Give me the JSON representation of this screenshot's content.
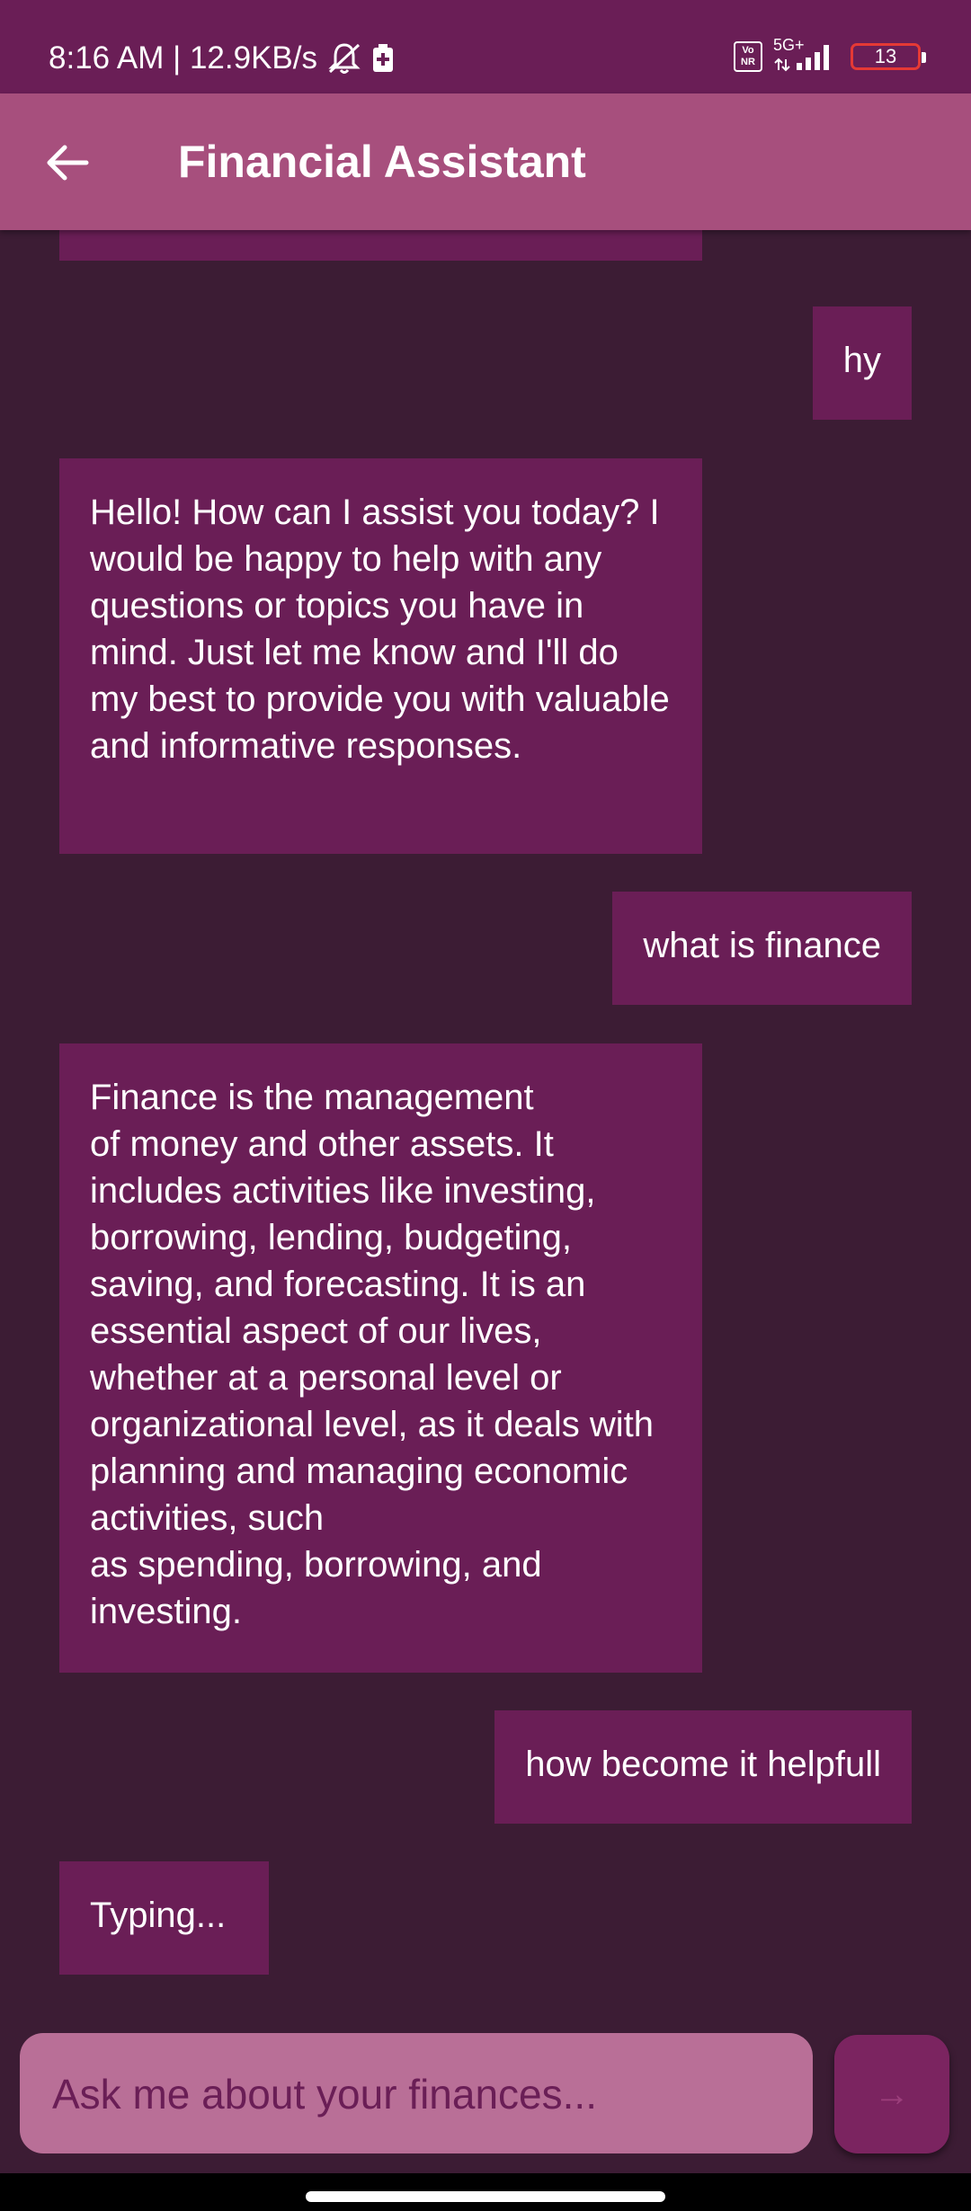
{
  "status_bar": {
    "time_speed": "8:16 AM | 12.9KB/s",
    "volte_top": "Vo",
    "volte_bottom": "NR",
    "network": "5G+",
    "battery": "13"
  },
  "header": {
    "title": "Financial Assistant",
    "back_icon": "arrow-left-icon"
  },
  "messages": [
    {
      "role": "bot",
      "text": ""
    },
    {
      "role": "user",
      "text": "hy"
    },
    {
      "role": "bot",
      "text": "Hello! How can I assist you today?  I would be happy to help with any questions or topics you have in mind. Just let me know and I'll do my best to provide you with valuable and informative responses."
    },
    {
      "role": "user",
      "text": "what is finance"
    },
    {
      "role": "bot",
      "text": "Finance is the management\nof money and other assets. It includes activities like investing, borrowing, lending, budgeting, saving, and forecasting. It is an essential aspect of our lives, whether at a personal level or organizational level, as it deals with planning and managing economic activities, such\nas spending, borrowing, and investing."
    },
    {
      "role": "user",
      "text": "how become it helpfull"
    },
    {
      "role": "bot",
      "text": "Typing..."
    }
  ],
  "composer": {
    "placeholder": "Ask me about your finances...",
    "send_icon": "arrow-right-icon"
  },
  "colors": {
    "status_bar": "#6a1e56",
    "app_bar": "#a74f7d",
    "background": "#3c1c34",
    "bubble": "#6a1e56",
    "input": "#b96f97",
    "send_button": "#7b2460",
    "battery_low": "#e53935"
  }
}
